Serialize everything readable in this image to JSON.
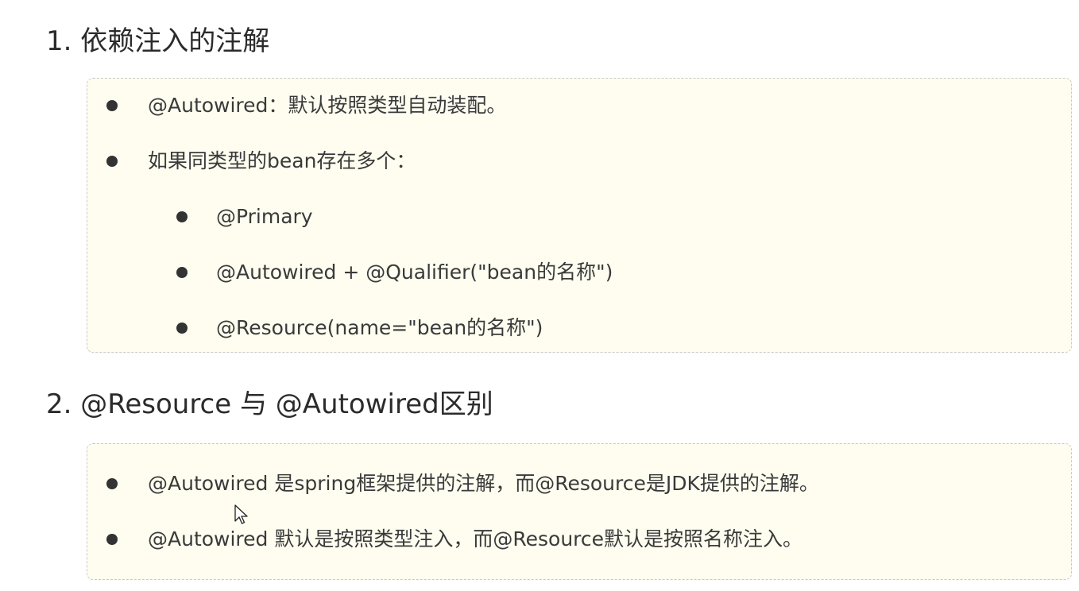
{
  "section1": {
    "title": "1. 依赖注入的注解",
    "items": [
      {
        "text": "@Autowired：默认按照类型自动装配。"
      },
      {
        "text": "如果同类型的bean存在多个："
      }
    ],
    "subitems": [
      {
        "text": "@Primary"
      },
      {
        "text": "@Autowired + @Qualifier(\"bean的名称\")"
      },
      {
        "text": "@Resource(name=\"bean的名称\")"
      }
    ]
  },
  "section2": {
    "title": "2. @Resource 与 @Autowired区别",
    "items": [
      {
        "text": "@Autowired 是spring框架提供的注解，而@Resource是JDK提供的注解。"
      },
      {
        "text": "@Autowired 默认是按照类型注入，而@Resource默认是按照名称注入。"
      }
    ]
  },
  "colors": {
    "box_background": "#fefdf0",
    "box_border": "#c9c9c9",
    "text": "#3a3a3a"
  },
  "icons": {
    "cursor": "mouse-pointer-icon"
  }
}
